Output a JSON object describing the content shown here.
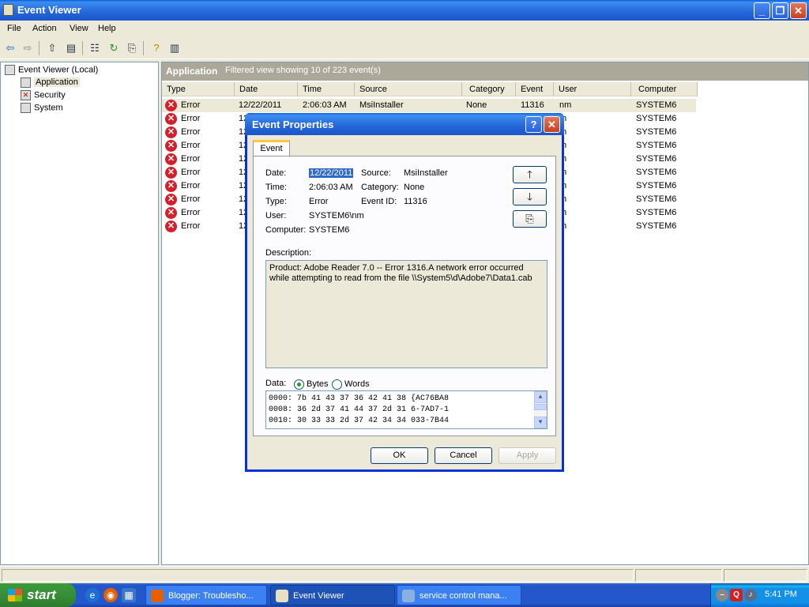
{
  "window": {
    "title": "Event Viewer"
  },
  "menu": [
    "File",
    "Action",
    "View",
    "Help"
  ],
  "tree": {
    "root": "Event Viewer (Local)",
    "items": [
      "Application",
      "Security",
      "System"
    ]
  },
  "pane": {
    "title": "Application",
    "subtitle": "Filtered view showing 10 of 223 event(s)"
  },
  "columns": [
    "Type",
    "Date",
    "Time",
    "Source",
    "Category",
    "Event",
    "User",
    "Computer"
  ],
  "rows": [
    {
      "type": "Error",
      "date": "12/22/2011",
      "time": "2:06:03 AM",
      "source": "MsiInstaller",
      "category": "None",
      "event": "11316",
      "user": "nm",
      "computer": "SYSTEM6"
    },
    {
      "type": "Error",
      "date": "12",
      "user": "m",
      "computer": "SYSTEM6"
    },
    {
      "type": "Error",
      "date": "12",
      "user": "m",
      "computer": "SYSTEM6"
    },
    {
      "type": "Error",
      "date": "12",
      "user": "m",
      "computer": "SYSTEM6"
    },
    {
      "type": "Error",
      "date": "12",
      "user": "m",
      "computer": "SYSTEM6"
    },
    {
      "type": "Error",
      "date": "12",
      "user": "m",
      "computer": "SYSTEM6"
    },
    {
      "type": "Error",
      "date": "12",
      "user": "m",
      "computer": "SYSTEM6"
    },
    {
      "type": "Error",
      "date": "12",
      "user": "m",
      "computer": "SYSTEM6"
    },
    {
      "type": "Error",
      "date": "12",
      "user": "m",
      "computer": "SYSTEM6"
    },
    {
      "type": "Error",
      "date": "12",
      "user": "m",
      "computer": "SYSTEM6"
    }
  ],
  "dialog": {
    "title": "Event Properties",
    "tab": "Event",
    "date_label": "Date:",
    "date": "12/22/2011",
    "source_label": "Source:",
    "source": "MsiInstaller",
    "time_label": "Time:",
    "time": "2:06:03 AM",
    "category_label": "Category:",
    "category": "None",
    "type_label": "Type:",
    "type": "Error",
    "eventid_label": "Event ID:",
    "eventid": "11316",
    "user_label": "User:",
    "user": "SYSTEM6\\nm",
    "computer_label": "Computer:",
    "computer": "SYSTEM6",
    "description_label": "Description:",
    "description": "Product: Adobe Reader 7.0 -- Error 1316.A network error occurred while attempting to read from the file \\\\System5\\d\\Adobe7\\Data1.cab",
    "data_label": "Data:",
    "bytes_label": "Bytes",
    "words_label": "Words",
    "data_lines": [
      "0000: 7b 41 43 37 36 42 41 38   {AC76BA8",
      "0008: 36 2d 37 41 44 37 2d 31   6-7AD7-1",
      "0010: 30 33 33 2d 37 42 34 34   033-7B44"
    ],
    "ok": "OK",
    "cancel": "Cancel",
    "apply": "Apply"
  },
  "taskbar": {
    "start": "start",
    "tasks": [
      "Blogger: Troublesho...",
      "Event Viewer",
      "service control mana..."
    ],
    "clock": "5:41 PM"
  }
}
